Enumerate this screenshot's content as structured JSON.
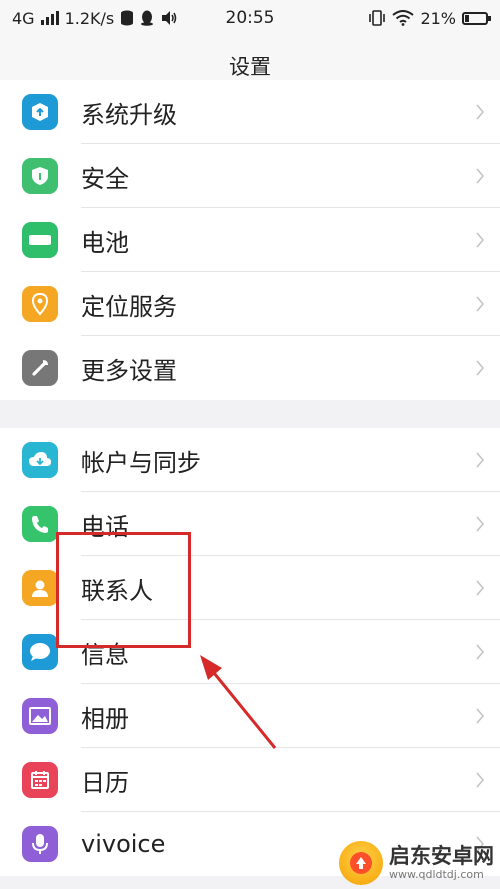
{
  "status_bar": {
    "network": "4G",
    "speed": "1.2K/s",
    "time": "20:55",
    "battery": "21%",
    "battery_level": 0.21
  },
  "nav": {
    "title": "设置"
  },
  "groups": [
    {
      "items": [
        {
          "label": "系统升级",
          "icon": "system-update-icon",
          "color": "#1e9bd7"
        },
        {
          "label": "安全",
          "icon": "shield-icon",
          "color": "#3fbf6f"
        },
        {
          "label": "电池",
          "icon": "battery-icon",
          "color": "#2fbf6a"
        },
        {
          "label": "定位服务",
          "icon": "location-icon",
          "color": "#f5a623"
        },
        {
          "label": "更多设置",
          "icon": "wrench-icon",
          "color": "#777777"
        }
      ]
    },
    {
      "items": [
        {
          "label": "帐户与同步",
          "icon": "cloud-sync-icon",
          "color": "#29b6d2"
        },
        {
          "label": "电话",
          "icon": "phone-icon",
          "color": "#35c46b"
        },
        {
          "label": "联系人",
          "icon": "contacts-icon",
          "color": "#f5a623"
        },
        {
          "label": "信息",
          "icon": "message-icon",
          "color": "#1e9bd7"
        },
        {
          "label": "相册",
          "icon": "gallery-icon",
          "color": "#8e5fd6"
        },
        {
          "label": "日历",
          "icon": "calendar-icon",
          "color": "#e9435a"
        },
        {
          "label": "vivoice",
          "icon": "microphone-icon",
          "color": "#8e5fd6"
        }
      ]
    }
  ],
  "watermark": {
    "title": "启东安卓网",
    "url": "www.qdldtdj.com"
  }
}
